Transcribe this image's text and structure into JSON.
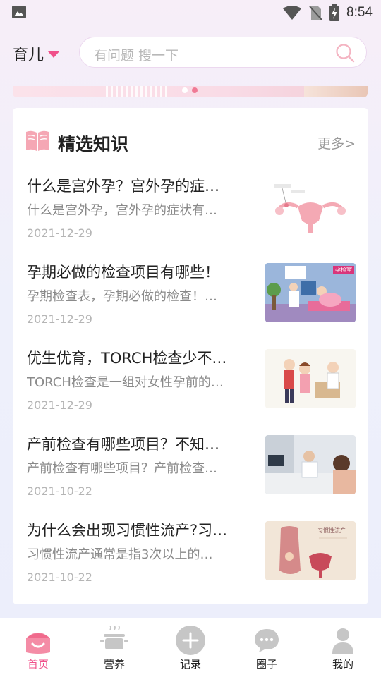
{
  "status_bar": {
    "time": "8:54",
    "icons": [
      "gallery-icon",
      "wifi-icon",
      "no-sim-icon",
      "battery-charging-icon"
    ]
  },
  "header": {
    "category": "育儿",
    "search_placeholder": "有问题 搜一下"
  },
  "colors": {
    "accent": "#f0508a",
    "icon_pink": "#f5a7b4",
    "nav_gray": "#c6c6c6",
    "text_primary": "#222222",
    "text_secondary": "#8a8a8a",
    "text_date": "#b5b5b5"
  },
  "knowledge": {
    "title": "精选知识",
    "more_label": "更多>",
    "articles": [
      {
        "title": "什么是宫外孕？宫外孕的症…",
        "summary": "什么是宫外孕，宫外孕的症状有…",
        "date": "2021-12-29",
        "thumb": "uterus-illustration"
      },
      {
        "title": "孕期必做的检查项目有哪些！",
        "summary": "孕期检查表，孕期必做的检查！…",
        "date": "2021-12-29",
        "thumb": "prenatal-checkup-illustration",
        "thumb_sign": "孕检室"
      },
      {
        "title": "优生优育，TORCH检查少不…",
        "summary": "TORCH检查是一组对女性孕前的…",
        "date": "2021-12-29",
        "thumb": "couple-doctor-illustration"
      },
      {
        "title": "产前检查有哪些项目？不知…",
        "summary": "产前检查有哪些项目？产前检查…",
        "date": "2021-10-22",
        "thumb": "doctor-consultation-photo"
      },
      {
        "title": "为什么会出现习惯性流产?习…",
        "summary": "习惯性流产通常是指3次以上的…",
        "date": "2021-10-22",
        "thumb": "miscarriage-illustration",
        "thumb_label": "习惯性流产"
      }
    ]
  },
  "bottom_nav": [
    {
      "label": "首页",
      "icon": "home-icon",
      "active": true
    },
    {
      "label": "营养",
      "icon": "pot-icon",
      "active": false
    },
    {
      "label": "记录",
      "icon": "add-circle-icon",
      "active": false
    },
    {
      "label": "圈子",
      "icon": "chat-bubble-icon",
      "active": false
    },
    {
      "label": "我的",
      "icon": "person-icon",
      "active": false
    }
  ]
}
